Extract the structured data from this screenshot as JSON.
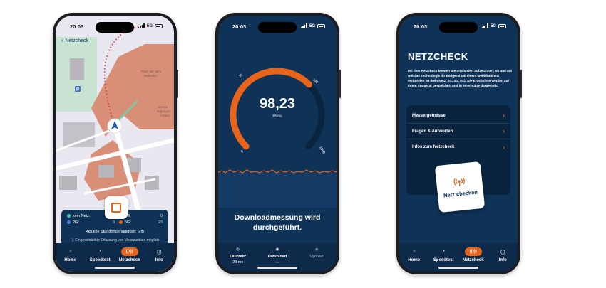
{
  "status": {
    "time": "20:03",
    "network": "5G"
  },
  "tabs": [
    "Home",
    "Speedtest",
    "Netzcheck",
    "Info"
  ],
  "phone1": {
    "back_label": "Netzcheck",
    "map_labels": [
      "Platz der Vere",
      "Nationen",
      "Messe",
      "Tagungsz",
      "entrum"
    ],
    "legend": [
      {
        "label": "kein Netz:",
        "value": "0",
        "color": "#3fc7b7"
      },
      {
        "label": "4G:",
        "value": "0",
        "color": "#b64fc6"
      },
      {
        "label": "2G:",
        "value": "0",
        "color": "#4a7bd8"
      },
      {
        "label": "5G:",
        "value": "23",
        "color": "#e8641b"
      }
    ],
    "accuracy": "Aktuelle Standortgenauigkeit: 6 m",
    "hint": "Eingeschränkte Erfassung von Messpunkten möglich"
  },
  "phone2": {
    "gauge": {
      "min": "0",
      "t10": "10",
      "t100": "100",
      "max": "1000",
      "fraction": 0.67
    },
    "speed": "98,23",
    "unit": "Mbit/s",
    "message": "Downloadmessung wird durchgeführt.",
    "stats": [
      {
        "label": "Laufzeit*",
        "value": "23 ms"
      },
      {
        "label": "Download",
        "value": "..."
      },
      {
        "label": "Upload",
        "value": ""
      }
    ]
  },
  "phone3": {
    "title": "NETZCHECK",
    "description": "Mit dem Netzcheck können Sie ortsbasiert aufzeichnen, ob und mit welcher Technologie Ihr Endgerät mit einem Mobilfunknetz verbunden ist (kein Netz, 2G, 4G, 5G). Die Ergebnisse werden auf Ihrem Endgerät gespeichert und in einer Karte dargestellt.",
    "menu": [
      "Messergebnisse",
      "Fragen & Antworten",
      "Infos zum Netzcheck"
    ],
    "button": "Netz checken"
  },
  "colors": {
    "accent": "#e8641b",
    "navy": "#0f3257"
  }
}
